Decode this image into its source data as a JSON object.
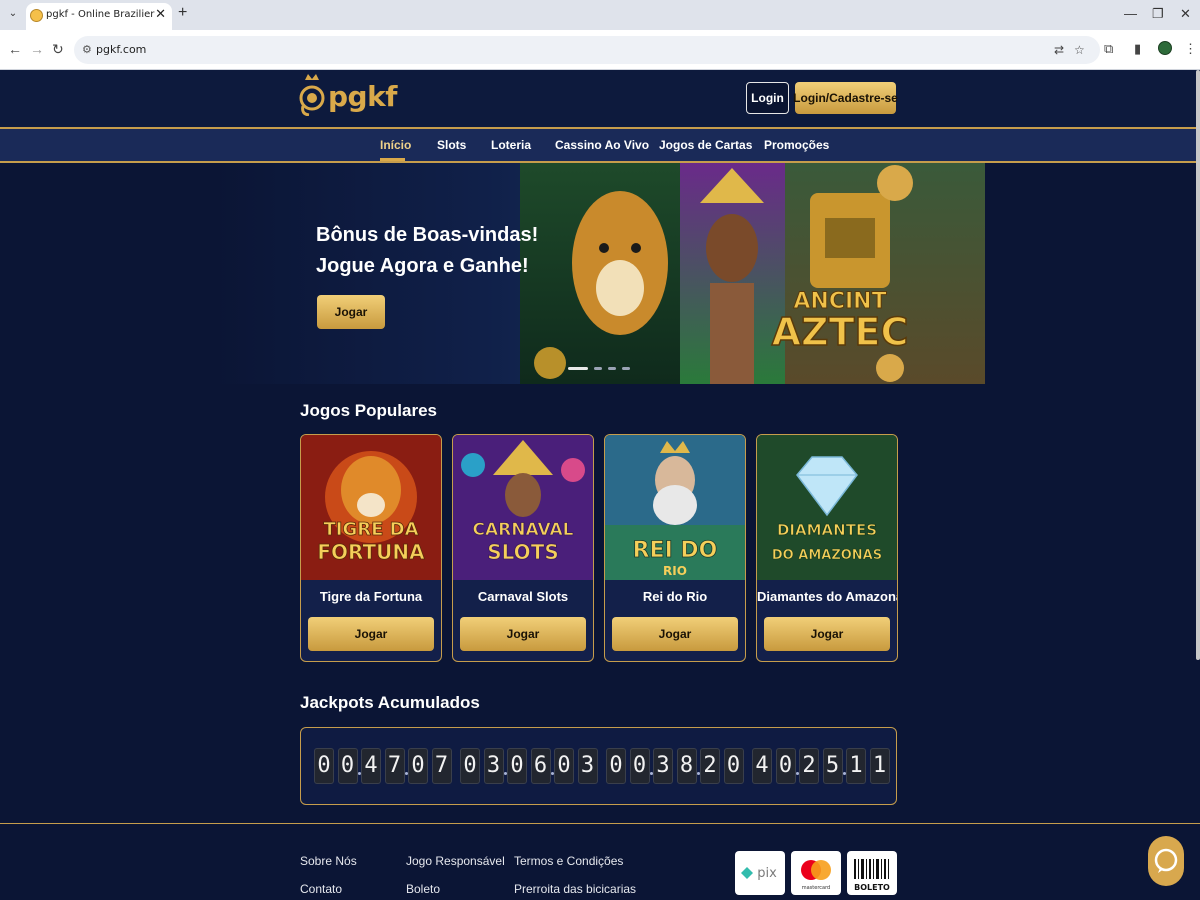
{
  "browser": {
    "tab_title": "pgkf - Online Brazilier",
    "tab_close": "✕",
    "new_tab": "+",
    "url": "pgkf.com"
  },
  "header": {
    "logo_text": "pgkf",
    "login_label": "Login",
    "register_label": "Login/Cadastre-se"
  },
  "nav": {
    "items": [
      {
        "label": "Início",
        "active": true
      },
      {
        "label": "Slots"
      },
      {
        "label": "Loteria"
      },
      {
        "label": "Cassino Ao Vivo"
      },
      {
        "label": "Jogos de Cartas"
      },
      {
        "label": "Promoções"
      }
    ]
  },
  "hero": {
    "title_line1": "Bônus de Boas-vindas!",
    "title_line2": "Jogue Agora e Ganhe!",
    "button_label": "Jogar",
    "art_text_line1": "ANCINT",
    "art_text_line2": "AZTEC",
    "slide_count": 4,
    "active_slide": 0
  },
  "popular": {
    "title": "Jogos Populares",
    "games": [
      {
        "name": "Tigre da Fortuna",
        "art_line1": "TIGRE DA",
        "art_line2": "FORTUNA",
        "button": "Jogar",
        "art_color": "#8a1d12"
      },
      {
        "name": "Carnaval Slots",
        "art_line1": "CARNAVAL",
        "art_line2": "SLOTS",
        "button": "Jogar",
        "art_color": "#4a1f7a"
      },
      {
        "name": "Rei do Rio",
        "art_line1": "REI DO",
        "art_line2": "RIO",
        "button": "Jogar",
        "art_color": "#2b6a8a"
      },
      {
        "name": "Diamantes do Amazonas",
        "art_line1": "DIAMANTES",
        "art_line2": "DO AMAZONAS",
        "button": "Jogar",
        "art_color": "#1f4a2a"
      }
    ]
  },
  "jackpots": {
    "title": "Jackpots Acumulados",
    "counters": [
      [
        "0",
        "0",
        "4",
        "7",
        "0",
        "7"
      ],
      [
        "0",
        "3",
        "0",
        "6",
        "0",
        "3"
      ],
      [
        "0",
        "0",
        "3",
        "8",
        "2",
        "0"
      ],
      [
        "4",
        "0",
        "2",
        "5",
        "1",
        "1"
      ]
    ]
  },
  "footer": {
    "col1": [
      "Sobre Nós",
      "Contato"
    ],
    "col2": [
      "Jogo Responsável",
      "Boleto"
    ],
    "col3": [
      "Termos e Condições",
      "Prerroita das bicicarias"
    ],
    "payments": [
      "pix",
      "mastercard",
      "BOLETO"
    ]
  },
  "colors": {
    "gold": "#c69d4c",
    "background": "#0b1535",
    "nav": "#1a2a58"
  }
}
